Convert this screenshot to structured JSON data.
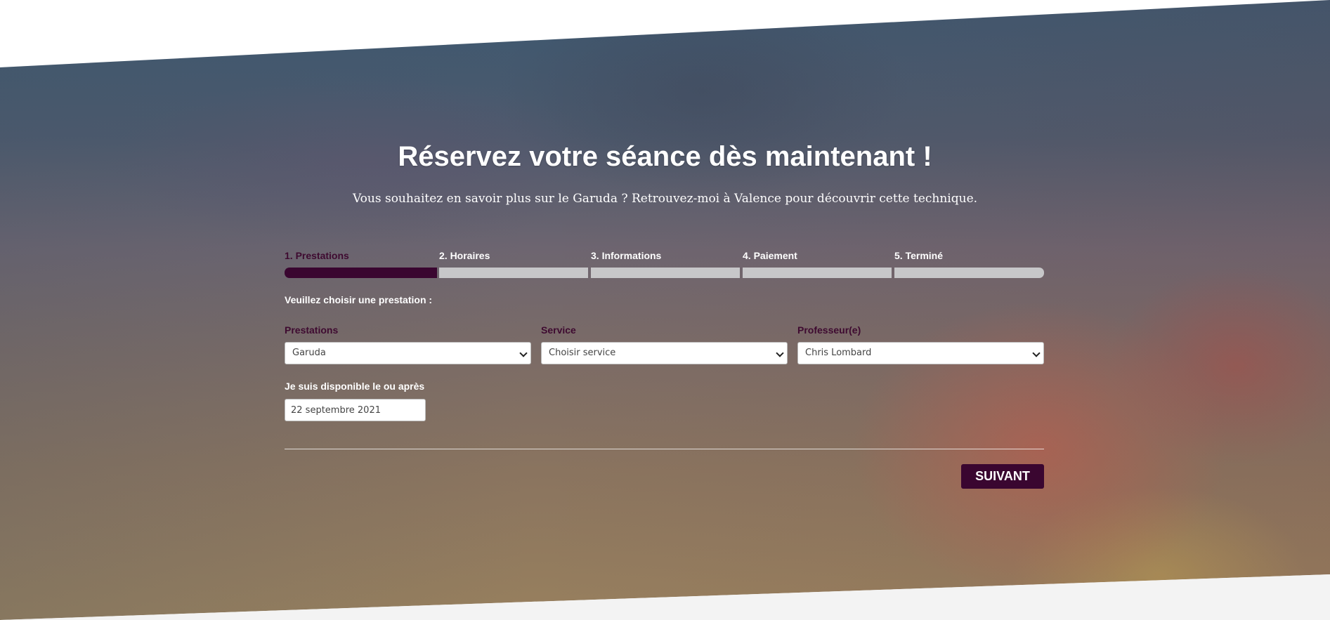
{
  "header": {
    "title": "Réservez votre séance dès maintenant !",
    "subtitle": "Vous souhaitez en savoir plus sur le Garuda ? Retrouvez-moi à Valence pour découvrir cette technique."
  },
  "wizard": {
    "steps": [
      {
        "label": "1. Prestations",
        "active": true
      },
      {
        "label": "2. Horaires",
        "active": false
      },
      {
        "label": "3. Informations",
        "active": false
      },
      {
        "label": "4. Paiement",
        "active": false
      },
      {
        "label": "5. Terminé",
        "active": false
      }
    ],
    "progress": 0.2
  },
  "form": {
    "prompt": "Veuillez choisir une prestation :",
    "prestations": {
      "label": "Prestations",
      "value": "Garuda"
    },
    "service": {
      "label": "Service",
      "value": "Choisir service"
    },
    "professeur": {
      "label": "Professeur(e)",
      "value": "Chris Lombard"
    },
    "date": {
      "label": "Je suis disponible le ou après",
      "value": "22 septembre 2021"
    },
    "next_label": "SUIVANT"
  },
  "colors": {
    "accent": "#3a0630",
    "step_inactive": "#c7c7c9",
    "field_label": "#3e0a30"
  }
}
